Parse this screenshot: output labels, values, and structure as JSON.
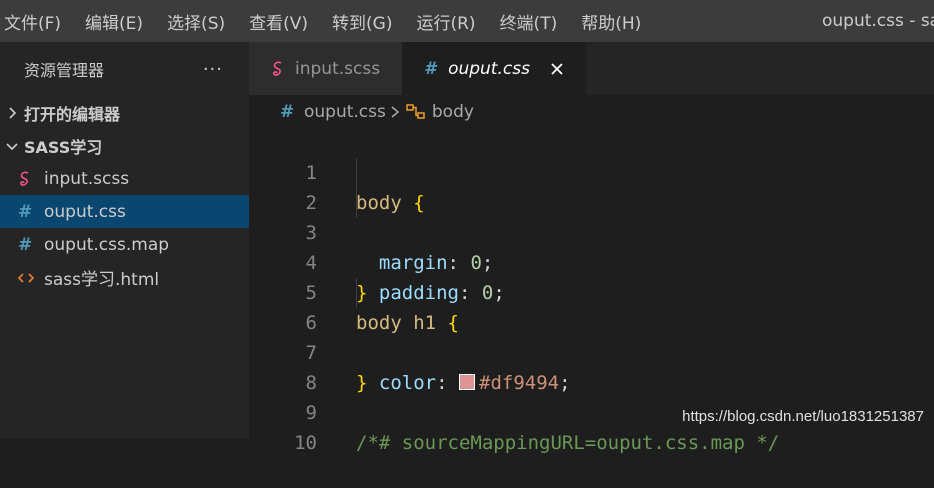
{
  "menubar": {
    "items": [
      "文件(F)",
      "编辑(E)",
      "选择(S)",
      "查看(V)",
      "转到(G)",
      "运行(R)",
      "终端(T)",
      "帮助(H)"
    ],
    "window_title": "ouput.css - sass学习"
  },
  "sidebar": {
    "title": "资源管理器",
    "more": "···",
    "open_editors": "打开的编辑器",
    "folder": "SASS学习",
    "files": [
      {
        "name": "input.scss",
        "icon": "sass-icon"
      },
      {
        "name": "ouput.css",
        "icon": "hash-icon"
      },
      {
        "name": "ouput.css.map",
        "icon": "hash-icon"
      },
      {
        "name": "sass学习.html",
        "icon": "html-icon"
      }
    ]
  },
  "tabs": [
    {
      "label": "input.scss",
      "icon": "sass-icon"
    },
    {
      "label": "ouput.css",
      "icon": "hash-icon"
    }
  ],
  "breadcrumb": {
    "file": "ouput.css",
    "symbol": "body"
  },
  "code": {
    "line_numbers": [
      "1",
      "2",
      "3",
      "4",
      "5",
      "6",
      "7",
      "8",
      "9",
      "10"
    ],
    "l1_sel": "body",
    "l1_brace": "{",
    "l2_prop": "margin",
    "l2_colon": ":",
    "l2_val": "0",
    "l2_semi": ";",
    "l3_prop": "padding",
    "l3_colon": ":",
    "l3_val": "0",
    "l3_semi": ";",
    "l4_brace": "}",
    "l5_sel": "body h1",
    "l5_brace": "{",
    "l6_prop": "color",
    "l6_colon": ":",
    "l6_val": "#df9494",
    "l6_semi": ";",
    "l7_brace": "}",
    "l9_comment": "/*# sourceMappingURL=ouput.css.map */"
  },
  "watermark": "https://blog.csdn.net/luo1831251387",
  "colors": {
    "accent_selection": "#094771",
    "swatch": "#df9494"
  }
}
